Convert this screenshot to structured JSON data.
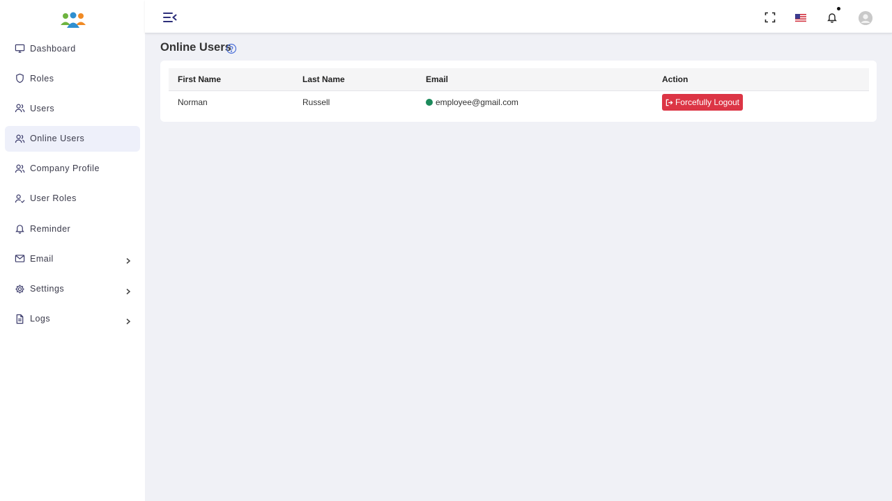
{
  "sidebar": {
    "items": [
      {
        "label": "Dashboard",
        "icon": "monitor-icon"
      },
      {
        "label": "Roles",
        "icon": "shield-icon"
      },
      {
        "label": "Users",
        "icon": "users-icon"
      },
      {
        "label": "Online Users",
        "icon": "users-icon",
        "active": true
      },
      {
        "label": "Company Profile",
        "icon": "users-icon"
      },
      {
        "label": "User Roles",
        "icon": "user-check-icon"
      },
      {
        "label": "Reminder",
        "icon": "bell-icon"
      },
      {
        "label": "Email",
        "icon": "mail-icon",
        "has_submenu": true
      },
      {
        "label": "Settings",
        "icon": "gear-icon",
        "has_submenu": true
      },
      {
        "label": "Logs",
        "icon": "file-icon",
        "has_submenu": true
      }
    ]
  },
  "topbar": {
    "icons": [
      "menu-collapse-icon",
      "fullscreen-icon",
      "us-flag-icon",
      "bell-icon",
      "avatar"
    ]
  },
  "main": {
    "title": "Online Users",
    "table": {
      "headers": [
        "First Name",
        "Last Name",
        "Email",
        "Action"
      ],
      "rows": [
        {
          "first_name": "Norman",
          "last_name": "Russell",
          "email": "employee@gmail.com",
          "status": "online",
          "action": "Forcefully Logout"
        }
      ]
    }
  },
  "colors": {
    "accent": "#2d2f7a",
    "danger": "#dc3545",
    "online": "#1c8a5b",
    "active_bg": "#eef0fa"
  }
}
